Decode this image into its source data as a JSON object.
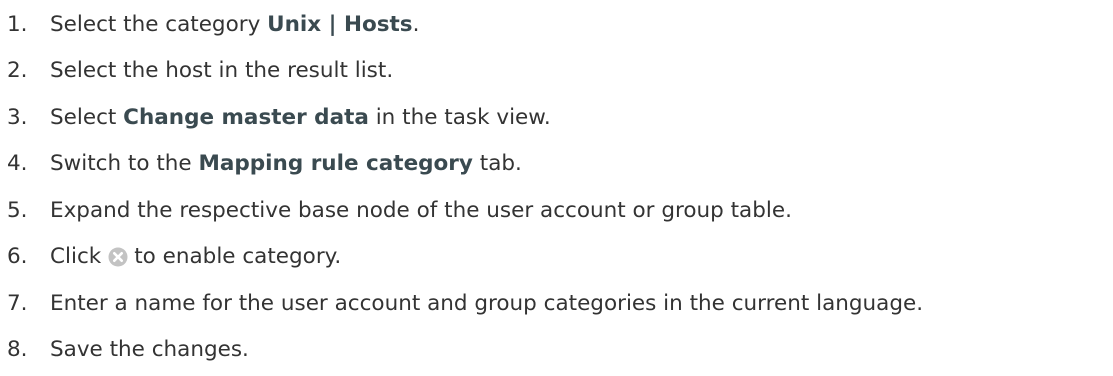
{
  "steps": [
    {
      "num": "1.",
      "before": "Select the category ",
      "bold": "Unix | Hosts",
      "after": "."
    },
    {
      "num": "2.",
      "text": "Select the host in the result list."
    },
    {
      "num": "3.",
      "before": "Select ",
      "bold": "Change master data",
      "after": " in the task view."
    },
    {
      "num": "4.",
      "before": "Switch to the ",
      "bold": "Mapping rule category",
      "after": " tab."
    },
    {
      "num": "5.",
      "text": "Expand the respective base node of the user account or group table."
    },
    {
      "num": "6.",
      "before": "Click",
      "icon": "disabled-category-icon",
      "after": "to enable category."
    },
    {
      "num": "7.",
      "text": "Enter a name for the user account and group categories in the current language."
    },
    {
      "num": "8.",
      "text": "Save the changes."
    }
  ],
  "colors": {
    "text": "#333333",
    "bold_text": "#3a4a50",
    "icon_fill": "#c3c3c3"
  }
}
